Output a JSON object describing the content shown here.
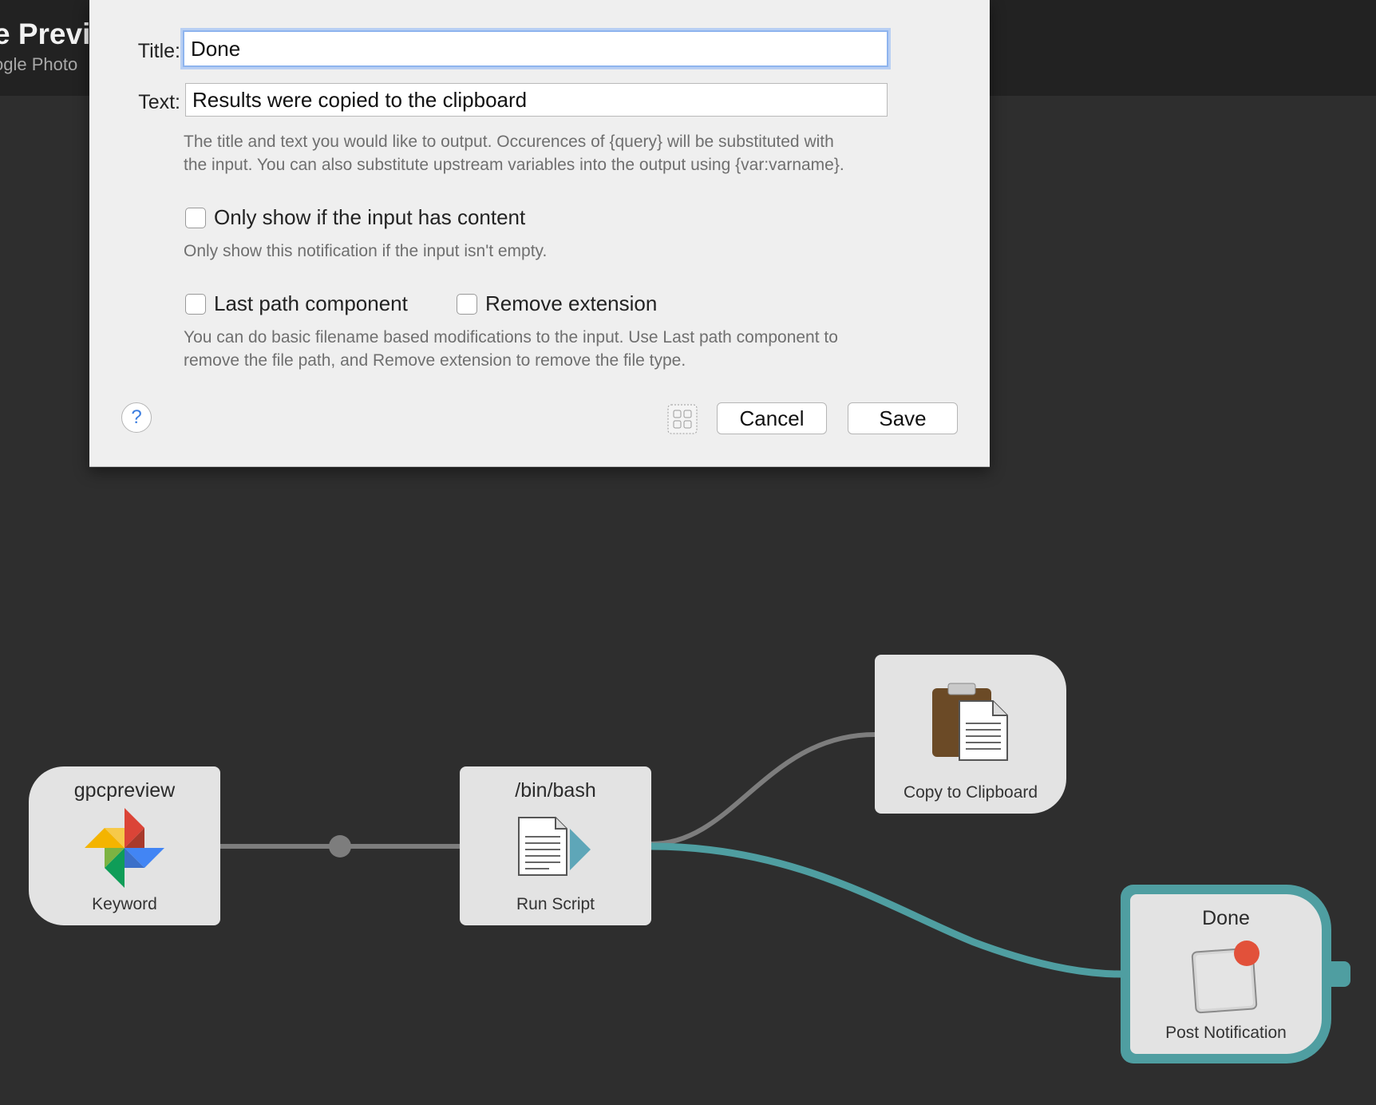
{
  "header": {
    "title": "e Previ",
    "subtitle": "ogle Photo"
  },
  "dialog": {
    "title_label": "Title:",
    "title_value": "Done",
    "text_label": "Text:",
    "text_value": "Results were copied to the clipboard",
    "description": "The title and text you would like to output. Occurences of {query} will be substituted with the input. You can also substitute upstream variables into the output using {var:varname}.",
    "description_line1": "The title and text you would like to output. Occurences of {query} will be substituted with",
    "description_line2": "the input. You can also substitute upstream variables into the output using {var:varname}.",
    "only_show_label": "Only show if the input has content",
    "only_show_help": "Only show this notification if the input isn't empty.",
    "last_path_label": "Last path component",
    "remove_ext_label": "Remove extension",
    "filename_help_line1": "You can do basic filename based modifications to the input. Use Last path component to",
    "filename_help_line2": "remove the file path, and Remove extension to remove the file type.",
    "help_button": "?",
    "cancel_label": "Cancel",
    "save_label": "Save",
    "checkbox_only_show": false,
    "checkbox_last_path": false,
    "checkbox_remove_ext": false
  },
  "workflow": {
    "keyword_node": {
      "title": "gpcpreview",
      "label": "Keyword"
    },
    "runscript_node": {
      "title": "/bin/bash",
      "label": "Run Script"
    },
    "clipboard_node": {
      "label": "Copy to Clipboard"
    },
    "notify_node": {
      "title": "Done",
      "label": "Post Notification"
    }
  },
  "colors": {
    "canvas_bg": "#2e2e2e",
    "header_bg": "#222222",
    "active_connection": "#4f9ea1",
    "connection": "#7d7d7d",
    "node_bg": "#e3e3e3",
    "focus_ring": "#8eb4ee"
  }
}
